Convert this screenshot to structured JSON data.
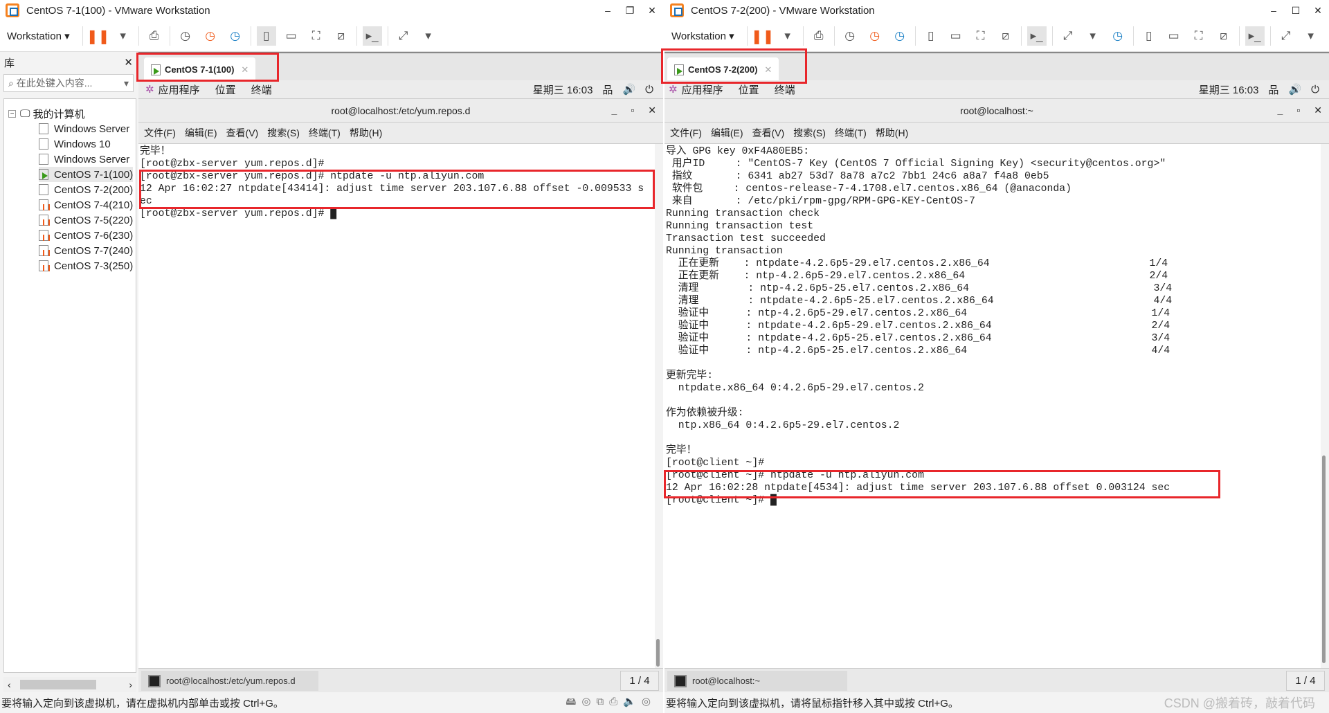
{
  "accent": "#e8262b",
  "left": {
    "window_title": "CentOS 7-1(100) - VMware Workstation",
    "menu": "Workstation",
    "library": {
      "title": "库",
      "search_placeholder": "在此处键入内容...",
      "root": "我的计算机",
      "items": [
        {
          "label": "Windows Server",
          "state": "off-plain"
        },
        {
          "label": "Windows 10",
          "state": "off-plain"
        },
        {
          "label": "Windows Server",
          "state": "off-plain"
        },
        {
          "label": "CentOS 7-1(100)",
          "state": "running"
        },
        {
          "label": "CentOS 7-2(200)",
          "state": "off-plain"
        },
        {
          "label": "CentOS 7-4(210)",
          "state": "paused"
        },
        {
          "label": "CentOS 7-5(220)",
          "state": "paused"
        },
        {
          "label": "CentOS 7-6(230)",
          "state": "paused"
        },
        {
          "label": "CentOS 7-7(240)",
          "state": "paused"
        },
        {
          "label": "CentOS 7-3(250)",
          "state": "paused"
        }
      ]
    },
    "tab": "CentOS 7-1(100)",
    "gnome": {
      "apps": "应用程序",
      "places": "位置",
      "terminal": "终端",
      "clock": "星期三 16:03"
    },
    "terminal_title": "root@localhost:/etc/yum.repos.d",
    "terminal_menu": [
      "文件(F)",
      "编辑(E)",
      "查看(V)",
      "搜索(S)",
      "终端(T)",
      "帮助(H)"
    ],
    "lines": [
      "完毕！",
      "[root@zbx-server yum.repos.d]# ",
      "[root@zbx-server yum.repos.d]# ntpdate -u ntp.aliyun.com",
      "12 Apr 16:02:27 ntpdate[43414]: adjust time server 203.107.6.88 offset -0.009533 s",
      "ec",
      "[root@zbx-server yum.repos.d]# █"
    ],
    "task": "root@localhost:/etc/yum.repos.d",
    "pager": "1 / 4",
    "status": "要将输入定向到该虚拟机，请在虚拟机内部单击或按 Ctrl+G。"
  },
  "right": {
    "window_title": "CentOS 7-2(200) - VMware Workstation",
    "menu": "Workstation",
    "tab": "CentOS 7-2(200)",
    "gnome": {
      "apps": "应用程序",
      "places": "位置",
      "terminal": "终端",
      "clock": "星期三 16:03"
    },
    "terminal_title": "root@localhost:~",
    "terminal_menu": [
      "文件(F)",
      "编辑(E)",
      "查看(V)",
      "搜索(S)",
      "终端(T)",
      "帮助(H)"
    ],
    "lines": [
      "导入 GPG key 0xF4A80EB5:",
      " 用户ID     : \"CentOS-7 Key (CentOS 7 Official Signing Key) <security@centos.org>\"",
      " 指纹       : 6341 ab27 53d7 8a78 a7c2 7bb1 24c6 a8a7 f4a8 0eb5",
      " 软件包     : centos-release-7-4.1708.el7.centos.x86_64 (@anaconda)",
      " 来自       : /etc/pki/rpm-gpg/RPM-GPG-KEY-CentOS-7",
      "Running transaction check",
      "Running transaction test",
      "Transaction test succeeded",
      "Running transaction",
      "  正在更新    : ntpdate-4.2.6p5-29.el7.centos.2.x86_64                          1/4",
      "  正在更新    : ntp-4.2.6p5-29.el7.centos.2.x86_64                              2/4",
      "  清理        : ntp-4.2.6p5-25.el7.centos.2.x86_64                              3/4",
      "  清理        : ntpdate-4.2.6p5-25.el7.centos.2.x86_64                          4/4",
      "  验证中      : ntp-4.2.6p5-29.el7.centos.2.x86_64                              1/4",
      "  验证中      : ntpdate-4.2.6p5-29.el7.centos.2.x86_64                          2/4",
      "  验证中      : ntpdate-4.2.6p5-25.el7.centos.2.x86_64                          3/4",
      "  验证中      : ntp-4.2.6p5-25.el7.centos.2.x86_64                              4/4",
      "",
      "更新完毕:",
      "  ntpdate.x86_64 0:4.2.6p5-29.el7.centos.2",
      "",
      "作为依赖被升级:",
      "  ntp.x86_64 0:4.2.6p5-29.el7.centos.2",
      "",
      "完毕！",
      "[root@client ~]# ",
      "[root@client ~]# ntpdate -u ntp.aliyun.com",
      "12 Apr 16:02:28 ntpdate[4534]: adjust time server 203.107.6.88 offset 0.003124 sec",
      "[root@client ~]# █"
    ],
    "task": "root@localhost:~",
    "pager": "1 / 4",
    "status": "要将输入定向到该虚拟机，请将鼠标指针移入其中或按 Ctrl+G。",
    "watermark": "CSDN @搬着砖，敲着代码"
  }
}
